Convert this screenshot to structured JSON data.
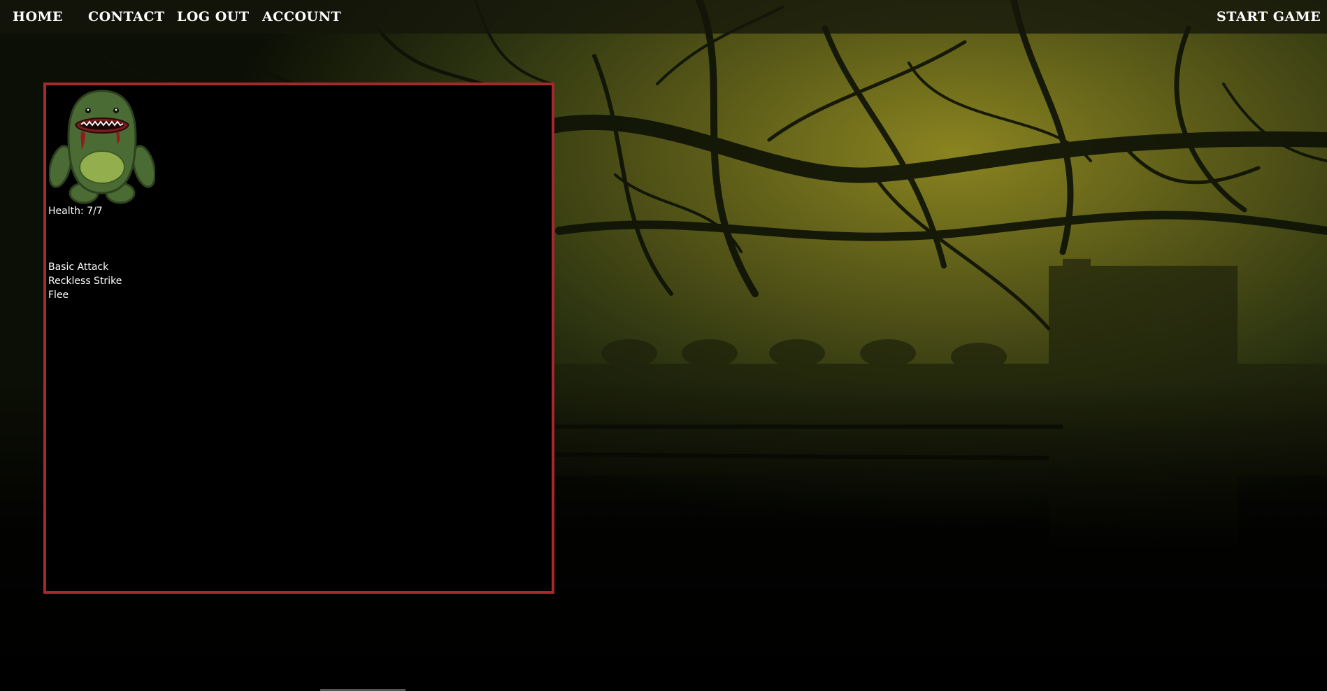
{
  "nav": {
    "home": "HOME",
    "contact": "CONTACT",
    "logout": "LOG OUT",
    "account": "ACCOUNT",
    "start_game": "START GAME"
  },
  "player": {
    "health_label": "Health:",
    "health_current": 7,
    "health_max": 7
  },
  "actions": [
    "Basic Attack",
    "Reckless Strike",
    "Flee"
  ],
  "colors": {
    "panel_border": "#a8272d",
    "monster_body": "#4a6b34",
    "monster_belly": "#93ae4c",
    "nav_text": "#ffffff"
  },
  "icons": {
    "monster": "green-blob-monster"
  }
}
